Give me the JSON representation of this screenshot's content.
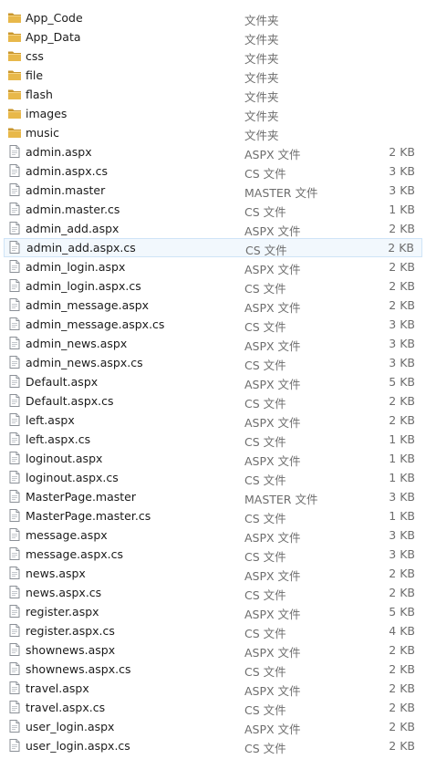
{
  "files": [
    {
      "name": "App_Code",
      "type": "文件夹",
      "size": "",
      "icon": "folder-icon"
    },
    {
      "name": "App_Data",
      "type": "文件夹",
      "size": "",
      "icon": "folder-icon"
    },
    {
      "name": "css",
      "type": "文件夹",
      "size": "",
      "icon": "folder-icon"
    },
    {
      "name": "file",
      "type": "文件夹",
      "size": "",
      "icon": "folder-icon"
    },
    {
      "name": "flash",
      "type": "文件夹",
      "size": "",
      "icon": "folder-icon"
    },
    {
      "name": "images",
      "type": "文件夹",
      "size": "",
      "icon": "folder-icon"
    },
    {
      "name": "music",
      "type": "文件夹",
      "size": "",
      "icon": "folder-icon"
    },
    {
      "name": "admin.aspx",
      "type": "ASPX 文件",
      "size": "2 KB",
      "icon": "document-icon"
    },
    {
      "name": "admin.aspx.cs",
      "type": "CS 文件",
      "size": "3 KB",
      "icon": "document-icon"
    },
    {
      "name": "admin.master",
      "type": "MASTER 文件",
      "size": "3 KB",
      "icon": "document-icon"
    },
    {
      "name": "admin.master.cs",
      "type": "CS 文件",
      "size": "1 KB",
      "icon": "document-icon"
    },
    {
      "name": "admin_add.aspx",
      "type": "ASPX 文件",
      "size": "2 KB",
      "icon": "document-icon"
    },
    {
      "name": "admin_add.aspx.cs",
      "type": "CS 文件",
      "size": "2 KB",
      "icon": "document-icon",
      "selected": true
    },
    {
      "name": "admin_login.aspx",
      "type": "ASPX 文件",
      "size": "2 KB",
      "icon": "document-icon"
    },
    {
      "name": "admin_login.aspx.cs",
      "type": "CS 文件",
      "size": "2 KB",
      "icon": "document-icon"
    },
    {
      "name": "admin_message.aspx",
      "type": "ASPX 文件",
      "size": "2 KB",
      "icon": "document-icon"
    },
    {
      "name": "admin_message.aspx.cs",
      "type": "CS 文件",
      "size": "3 KB",
      "icon": "document-icon"
    },
    {
      "name": "admin_news.aspx",
      "type": "ASPX 文件",
      "size": "3 KB",
      "icon": "document-icon"
    },
    {
      "name": "admin_news.aspx.cs",
      "type": "CS 文件",
      "size": "3 KB",
      "icon": "document-icon"
    },
    {
      "name": "Default.aspx",
      "type": "ASPX 文件",
      "size": "5 KB",
      "icon": "document-icon"
    },
    {
      "name": "Default.aspx.cs",
      "type": "CS 文件",
      "size": "2 KB",
      "icon": "document-icon"
    },
    {
      "name": "left.aspx",
      "type": "ASPX 文件",
      "size": "2 KB",
      "icon": "document-icon"
    },
    {
      "name": "left.aspx.cs",
      "type": "CS 文件",
      "size": "1 KB",
      "icon": "document-icon"
    },
    {
      "name": "loginout.aspx",
      "type": "ASPX 文件",
      "size": "1 KB",
      "icon": "document-icon"
    },
    {
      "name": "loginout.aspx.cs",
      "type": "CS 文件",
      "size": "1 KB",
      "icon": "document-icon"
    },
    {
      "name": "MasterPage.master",
      "type": "MASTER 文件",
      "size": "3 KB",
      "icon": "document-icon"
    },
    {
      "name": "MasterPage.master.cs",
      "type": "CS 文件",
      "size": "1 KB",
      "icon": "document-icon"
    },
    {
      "name": "message.aspx",
      "type": "ASPX 文件",
      "size": "3 KB",
      "icon": "document-icon"
    },
    {
      "name": "message.aspx.cs",
      "type": "CS 文件",
      "size": "3 KB",
      "icon": "document-icon"
    },
    {
      "name": "news.aspx",
      "type": "ASPX 文件",
      "size": "2 KB",
      "icon": "document-icon"
    },
    {
      "name": "news.aspx.cs",
      "type": "CS 文件",
      "size": "2 KB",
      "icon": "document-icon"
    },
    {
      "name": "register.aspx",
      "type": "ASPX 文件",
      "size": "5 KB",
      "icon": "document-icon"
    },
    {
      "name": "register.aspx.cs",
      "type": "CS 文件",
      "size": "4 KB",
      "icon": "document-icon"
    },
    {
      "name": "shownews.aspx",
      "type": "ASPX 文件",
      "size": "2 KB",
      "icon": "document-icon"
    },
    {
      "name": "shownews.aspx.cs",
      "type": "CS 文件",
      "size": "2 KB",
      "icon": "document-icon"
    },
    {
      "name": "travel.aspx",
      "type": "ASPX 文件",
      "size": "2 KB",
      "icon": "document-icon"
    },
    {
      "name": "travel.aspx.cs",
      "type": "CS 文件",
      "size": "2 KB",
      "icon": "document-icon"
    },
    {
      "name": "user_login.aspx",
      "type": "ASPX 文件",
      "size": "2 KB",
      "icon": "document-icon"
    },
    {
      "name": "user_login.aspx.cs",
      "type": "CS 文件",
      "size": "2 KB",
      "icon": "document-icon"
    }
  ],
  "colors": {
    "folder": "#e8b84a",
    "folder_dark": "#c9962c",
    "document_border": "#8a8f96",
    "selection_bg": "#f2f8fd",
    "selection_border": "#cfe4f7"
  }
}
